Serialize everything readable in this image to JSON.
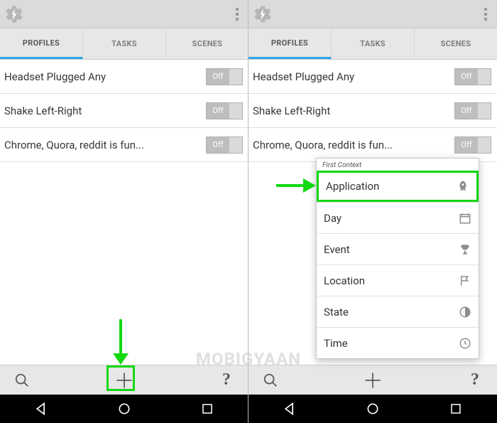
{
  "app": {
    "name": "Tasker"
  },
  "tabs": {
    "profiles": "PROFILES",
    "tasks": "TASKS",
    "scenes": "SCENES",
    "active": "profiles"
  },
  "profiles": [
    {
      "label": "Headset Plugged Any",
      "state": "Off"
    },
    {
      "label": "Shake Left-Right",
      "state": "Off"
    },
    {
      "label": "Chrome, Quora, reddit is fun...",
      "state": "Off"
    }
  ],
  "right_profiles": [
    {
      "label": "Headset Plugged Any",
      "state": "Off"
    },
    {
      "label": "Shake Left-Right",
      "state": "Off"
    },
    {
      "label": "Chrome, Quora, reddit is fun...",
      "state": "Off"
    }
  ],
  "bottom": {
    "search": "search",
    "add": "+",
    "help": "?"
  },
  "context_menu": {
    "title": "First Context",
    "items": [
      "Application",
      "Day",
      "Event",
      "Location",
      "State",
      "Time"
    ]
  },
  "watermark": "MOBIGYAAN"
}
